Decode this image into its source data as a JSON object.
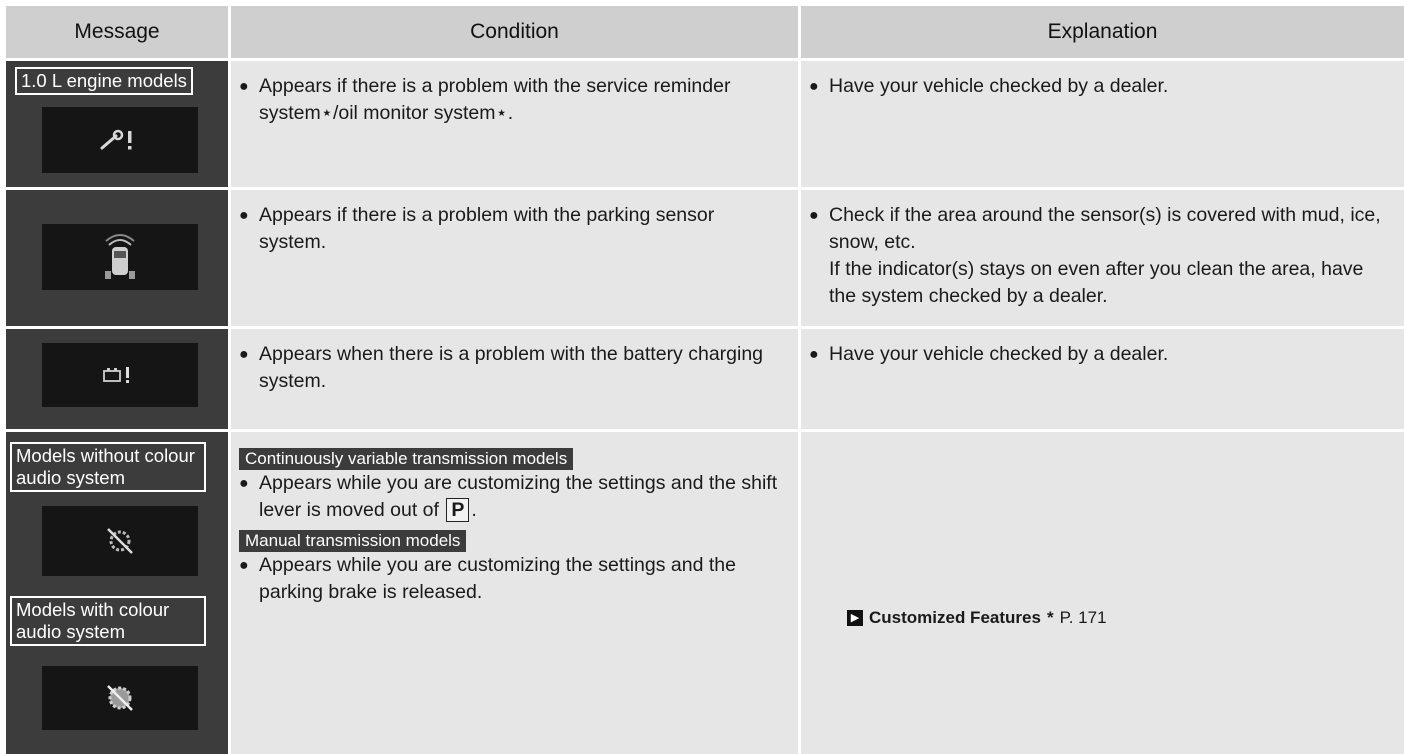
{
  "header": {
    "message": "Message",
    "condition": "Condition",
    "explanation": "Explanation"
  },
  "rows": [
    {
      "tag": "1.0 L engine models",
      "icon": "wrench-exclamation-icon",
      "condition": "Appears if there is a problem with the service reminder system⋆/oil monitor system⋆.",
      "explanation": "Have your vehicle checked by a dealer."
    },
    {
      "icon": "parking-sensor-car-icon",
      "condition": "Appears if there is a problem with the parking sensor system.",
      "explanation": "Check if the area around the sensor(s) is covered with mud, ice, snow, etc.",
      "explanation_note": "If the indicator(s) stays on even after you clean the area, have the system checked by a dealer."
    },
    {
      "icon": "battery-exclamation-icon",
      "condition": "Appears when there is a problem with the battery charging system.",
      "explanation": "Have your vehicle checked by a dealer."
    },
    {
      "tag_top": "Models without colour audio system",
      "tag_bottom": "Models with colour audio system",
      "icon_top": "gear-crossed-icon",
      "icon_bottom": "gear-crossed-icon",
      "cvt_label": "Continuously variable transmission models",
      "cvt_condition_before": "Appears while you are customizing the settings and the shift lever is moved out of",
      "cvt_key": "P",
      "cvt_condition_after": ".",
      "mt_label": "Manual transmission models",
      "mt_condition": "Appears while you are customizing the settings and the parking brake is released.",
      "ref_title": "Customized Features",
      "ref_star": "*",
      "ref_page": "P. 171"
    }
  ],
  "colors": {
    "header_bg": "#cfcfcf",
    "cell_bg": "#e6e6e6",
    "message_bg": "#3c3c3c",
    "screen_bg": "#151515"
  }
}
